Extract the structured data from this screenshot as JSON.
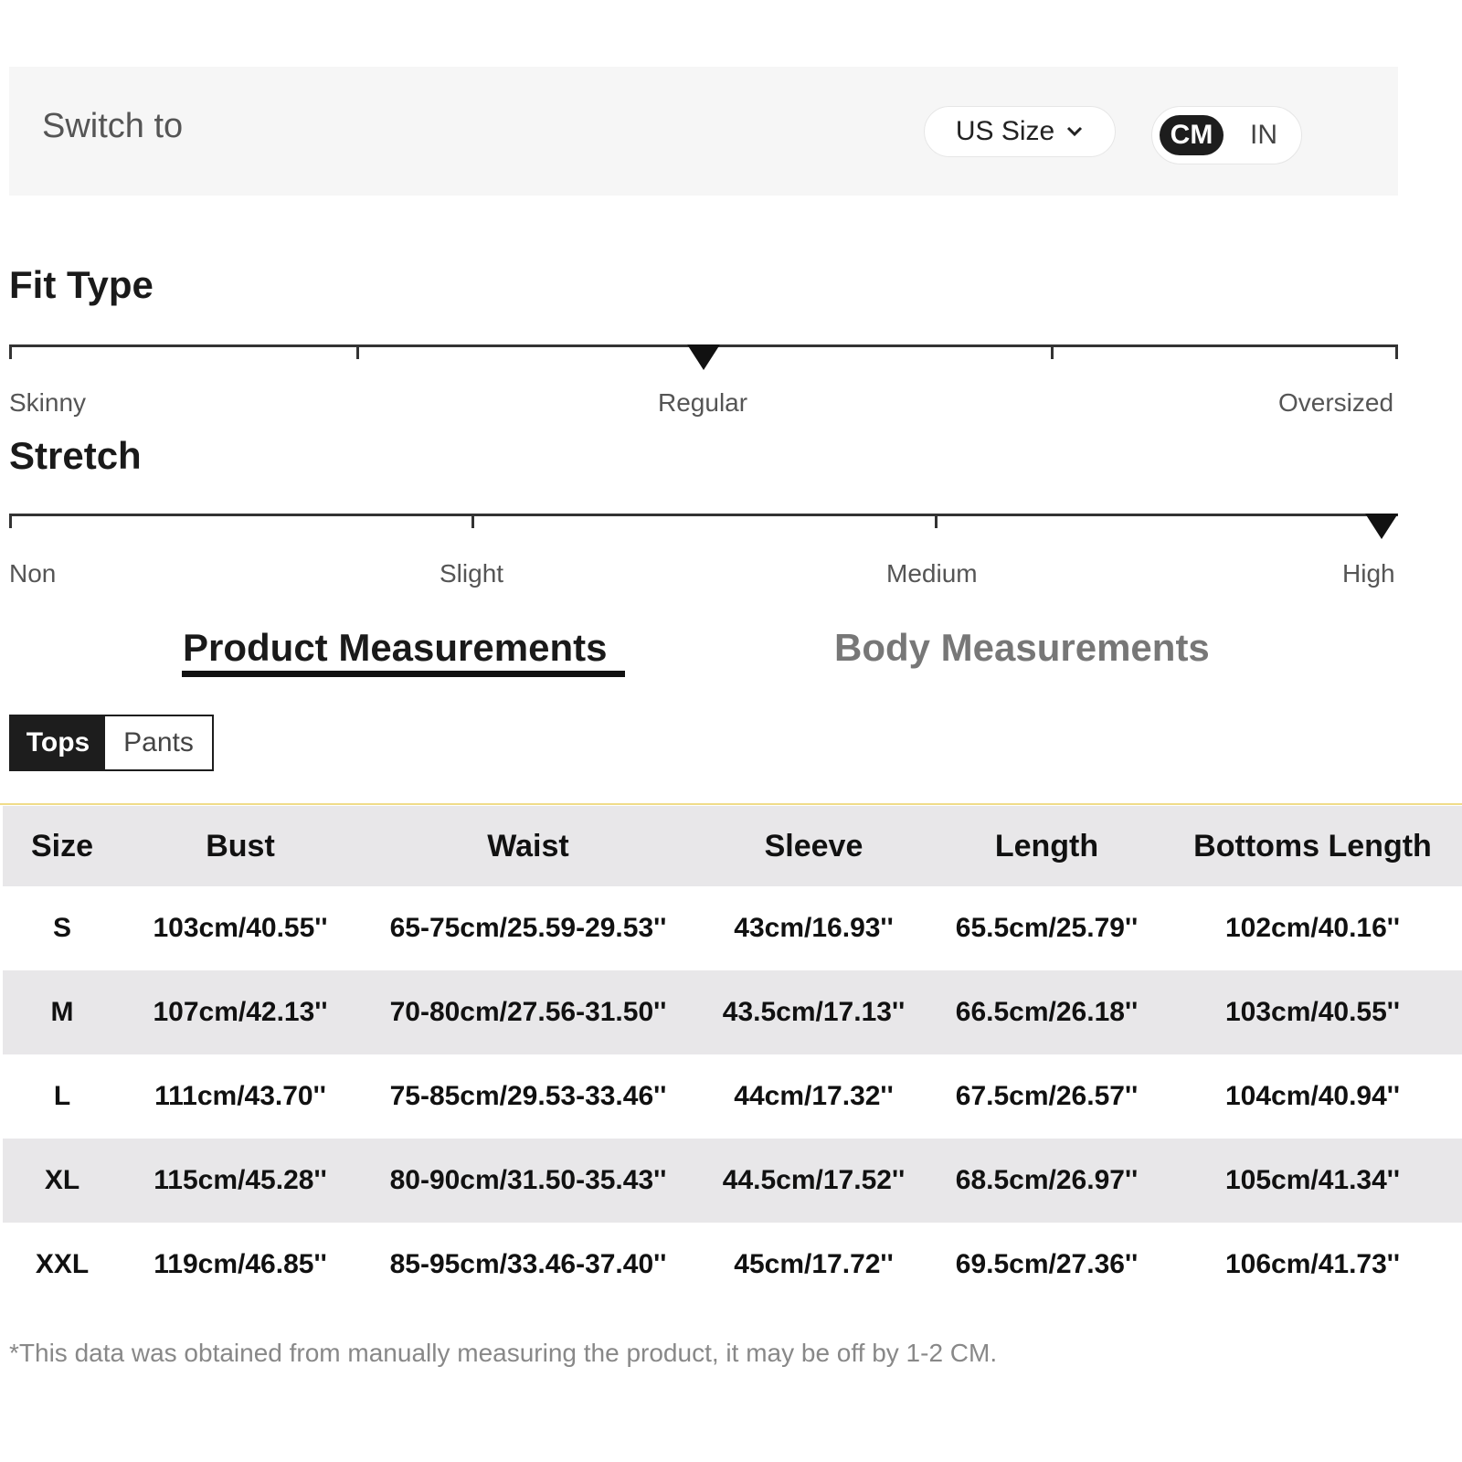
{
  "switch_bar": {
    "label": "Switch to",
    "size_system": "US Size",
    "units": {
      "cm": "CM",
      "in": "IN",
      "selected": "CM"
    }
  },
  "fit_type": {
    "title": "Fit Type",
    "labels": [
      "Skinny",
      "Regular",
      "Oversized"
    ],
    "selected": "Regular",
    "marker_level": 0.5
  },
  "stretch": {
    "title": "Stretch",
    "labels": [
      "Non",
      "Slight",
      "Medium",
      "High"
    ],
    "selected": "High",
    "marker_level": 1.0
  },
  "measurement_tabs": {
    "product": "Product Measurements",
    "body": "Body Measurements",
    "selected": "product"
  },
  "category_tabs": {
    "tops": "Tops",
    "pants": "Pants",
    "selected": "tops"
  },
  "table": {
    "headers": [
      "Size",
      "Bust",
      "Waist",
      "Sleeve",
      "Length",
      "Bottoms Length"
    ],
    "rows": [
      [
        "S",
        "103cm/40.55''",
        "65-75cm/25.59-29.53''",
        "43cm/16.93''",
        "65.5cm/25.79''",
        "102cm/40.16''"
      ],
      [
        "M",
        "107cm/42.13''",
        "70-80cm/27.56-31.50''",
        "43.5cm/17.13''",
        "66.5cm/26.18''",
        "103cm/40.55''"
      ],
      [
        "L",
        "111cm/43.70''",
        "75-85cm/29.53-33.46''",
        "44cm/17.32''",
        "67.5cm/26.57''",
        "104cm/40.94''"
      ],
      [
        "XL",
        "115cm/45.28''",
        "80-90cm/31.50-35.43''",
        "44.5cm/17.52''",
        "68.5cm/26.97''",
        "105cm/41.34''"
      ],
      [
        "XXL",
        "119cm/46.85''",
        "85-95cm/33.46-37.40''",
        "45cm/17.72''",
        "69.5cm/27.36''",
        "106cm/41.73''"
      ]
    ]
  },
  "footnote": "*This data was obtained from manually measuring the product, it may be off by 1-2 CM.",
  "colors": {
    "accent": "#1d1d1d",
    "stripe": "#e8e7e9",
    "header_line": "#f0dc8a"
  }
}
